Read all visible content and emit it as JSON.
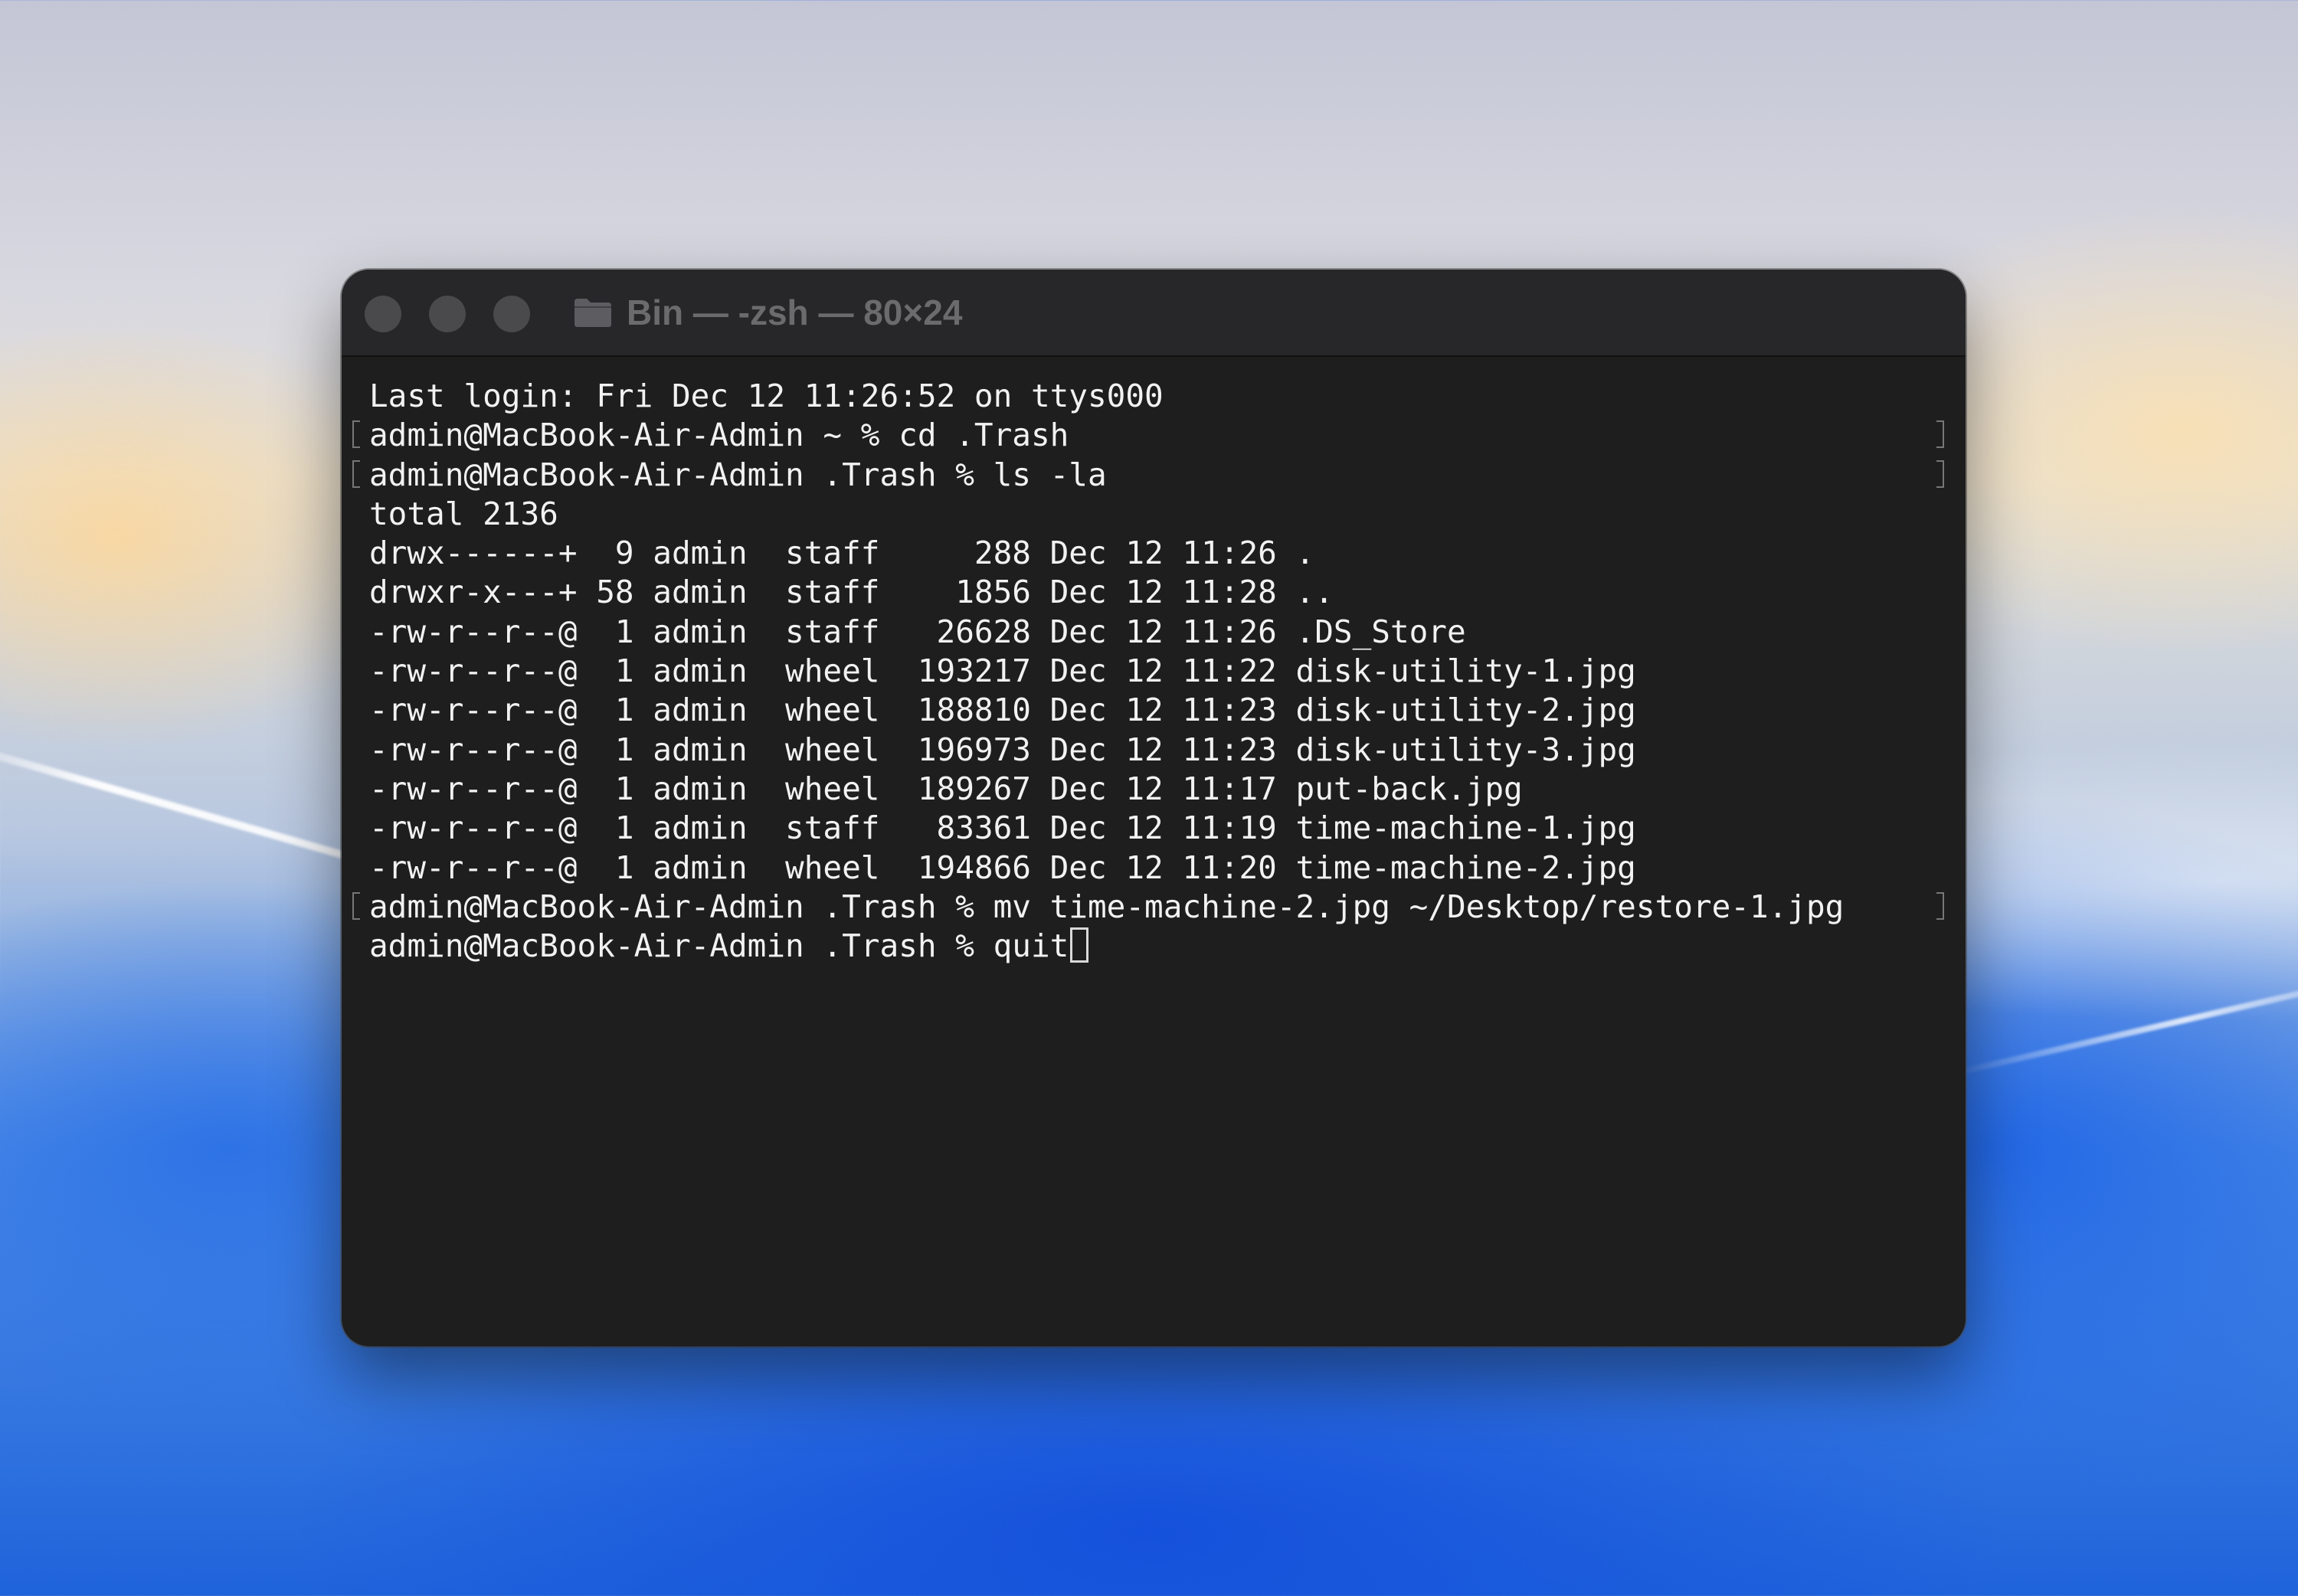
{
  "window": {
    "title": "Bin — -zsh — 80×24",
    "folder_icon": "folder-icon"
  },
  "terminal": {
    "lines": [
      "Last login: Fri Dec 12 11:26:52 on ttys000",
      "admin@MacBook-Air-Admin ~ % cd .Trash",
      "admin@MacBook-Air-Admin .Trash % ls -la",
      "total 2136",
      "drwx------+  9 admin  staff     288 Dec 12 11:26 .",
      "drwxr-x---+ 58 admin  staff    1856 Dec 12 11:28 ..",
      "-rw-r--r--@  1 admin  staff   26628 Dec 12 11:26 .DS_Store",
      "-rw-r--r--@  1 admin  wheel  193217 Dec 12 11:22 disk-utility-1.jpg",
      "-rw-r--r--@  1 admin  wheel  188810 Dec 12 11:23 disk-utility-2.jpg",
      "-rw-r--r--@  1 admin  wheel  196973 Dec 12 11:23 disk-utility-3.jpg",
      "-rw-r--r--@  1 admin  wheel  189267 Dec 12 11:17 put-back.jpg",
      "-rw-r--r--@  1 admin  staff   83361 Dec 12 11:19 time-machine-1.jpg",
      "-rw-r--r--@  1 admin  wheel  194866 Dec 12 11:20 time-machine-2.jpg",
      "admin@MacBook-Air-Admin .Trash % mv time-machine-2.jpg ~/Desktop/restore-1.jpg",
      "admin@MacBook-Air-Admin .Trash % quit"
    ]
  }
}
